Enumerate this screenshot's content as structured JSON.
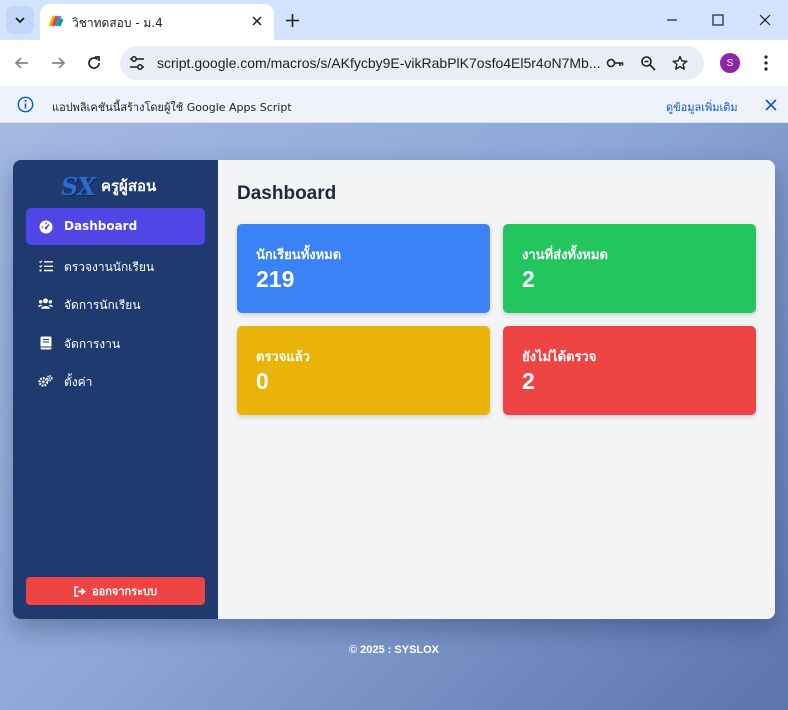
{
  "browser": {
    "tab_title": "วิชาทดสอบ - ม.4",
    "url": "script.google.com/macros/s/AKfycby9E-vikRabPlK7osfo4El5r4oN7Mb...",
    "profile_initial": "S",
    "profile_color": "#8e24aa",
    "icons": [
      "tab-search-icon",
      "close-icon",
      "plus-icon",
      "minimize-icon",
      "maximize-icon",
      "back-icon",
      "forward-icon",
      "reload-icon",
      "tune-icon",
      "key-icon",
      "zoom-icon",
      "star-icon",
      "menu-dots-icon",
      "info-icon"
    ]
  },
  "infobar": {
    "message": "แอปพลิเคชันนี้สร้างโดยผู้ใช้ Google Apps Script",
    "link": "ดูข้อมูลเพิ่มเติม"
  },
  "sidebar": {
    "logo": "SX",
    "title": "ครูผู้สอน",
    "items": [
      {
        "label": "Dashboard",
        "icon": "gauge-icon",
        "active": true
      },
      {
        "label": "ตรวจงานนักเรียน",
        "icon": "checklist-icon",
        "active": false
      },
      {
        "label": "จัดการนักเรียน",
        "icon": "users-icon",
        "active": false
      },
      {
        "label": "จัดการงาน",
        "icon": "book-icon",
        "active": false
      },
      {
        "label": "ตั้งค่า",
        "icon": "gears-icon",
        "active": false
      }
    ],
    "logout_label": "ออกจากระบบ"
  },
  "main": {
    "title": "Dashboard",
    "cards": [
      {
        "label": "นักเรียนทั้งหมด",
        "value": "219",
        "color": "#3b82f6"
      },
      {
        "label": "งานที่ส่งทั้งหมด",
        "value": "2",
        "color": "#22c55e"
      },
      {
        "label": "ตรวจแล้ว",
        "value": "0",
        "color": "#eab308"
      },
      {
        "label": "ยังไม่ได้ตรวจ",
        "value": "2",
        "color": "#ef4444"
      }
    ]
  },
  "footer": {
    "text": "© 2025 : SYSLOX"
  },
  "colors": {
    "sidebar_bg": "#1e3a6e",
    "active_nav": "#4f46e5",
    "logout": "#ef4444"
  }
}
